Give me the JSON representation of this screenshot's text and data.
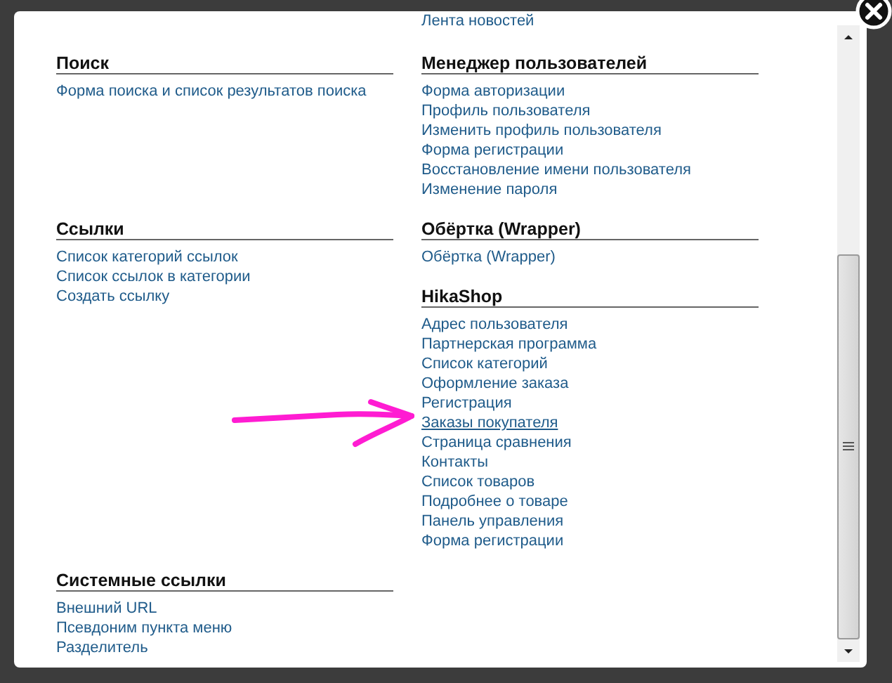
{
  "rows": [
    {
      "right": [
        {
          "links": [
            {
              "label": "Лента новостей",
              "hovered": false
            }
          ]
        }
      ]
    },
    {
      "left": [
        {
          "title": "Поиск",
          "links": [
            {
              "label": "Форма поиска и список результатов поиска",
              "hovered": false
            }
          ]
        }
      ],
      "right": [
        {
          "title": "Менеджер пользователей",
          "links": [
            {
              "label": "Форма авторизации",
              "hovered": false
            },
            {
              "label": "Профиль пользователя",
              "hovered": false
            },
            {
              "label": "Изменить профиль пользователя",
              "hovered": false
            },
            {
              "label": "Форма регистрации",
              "hovered": false
            },
            {
              "label": "Восстановление имени пользователя",
              "hovered": false
            },
            {
              "label": "Изменение пароля",
              "hovered": false
            }
          ]
        }
      ]
    },
    {
      "left": [
        {
          "title": "Ссылки",
          "links": [
            {
              "label": "Список категорий ссылок",
              "hovered": false
            },
            {
              "label": "Список ссылок в категории",
              "hovered": false
            },
            {
              "label": "Создать ссылку",
              "hovered": false
            }
          ]
        }
      ],
      "right": [
        {
          "title": "Обёртка (Wrapper)",
          "links": [
            {
              "label": "Обёртка (Wrapper)",
              "hovered": false
            }
          ]
        },
        {
          "title": "HikaShop",
          "links": [
            {
              "label": "Адрес пользователя",
              "hovered": false
            },
            {
              "label": "Партнерская программа",
              "hovered": false
            },
            {
              "label": "Список категорий",
              "hovered": false
            },
            {
              "label": "Оформление заказа",
              "hovered": false
            },
            {
              "label": "Регистрация",
              "hovered": false
            },
            {
              "label": "Заказы покупателя",
              "hovered": true
            },
            {
              "label": "Страница сравнения",
              "hovered": false
            },
            {
              "label": "Контакты",
              "hovered": false
            },
            {
              "label": "Список товаров",
              "hovered": false
            },
            {
              "label": "Подробнее о товаре",
              "hovered": false
            },
            {
              "label": "Панель управления",
              "hovered": false
            },
            {
              "label": "Форма регистрации",
              "hovered": false
            }
          ]
        }
      ]
    },
    {
      "left": [
        {
          "title": "Системные ссылки",
          "links": [
            {
              "label": "Внешний URL",
              "hovered": false
            },
            {
              "label": "Псевдоним пункта меню",
              "hovered": false
            },
            {
              "label": "Разделитель",
              "hovered": false
            }
          ]
        }
      ]
    }
  ],
  "annotation": {
    "kind": "arrow"
  }
}
